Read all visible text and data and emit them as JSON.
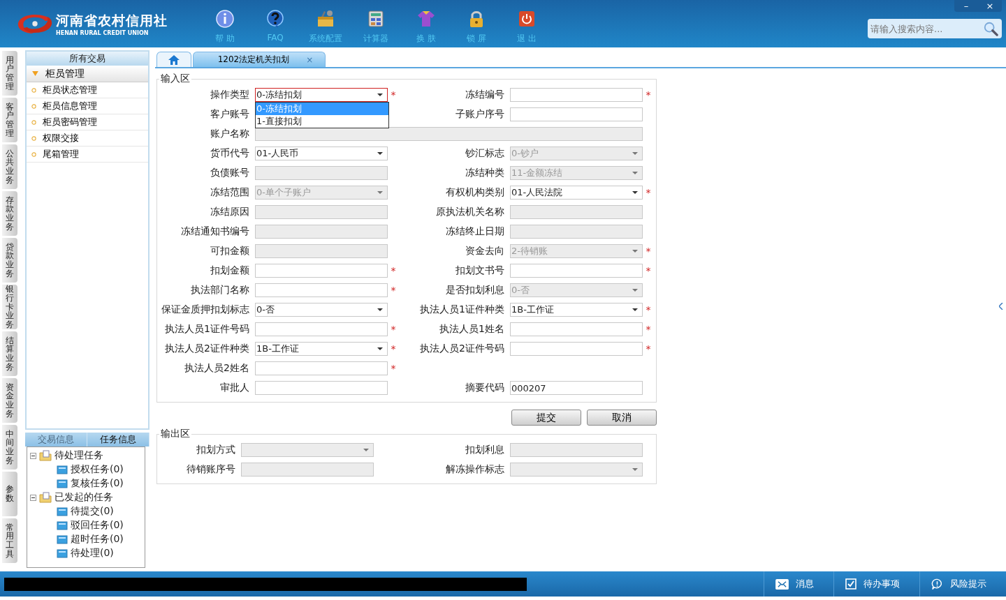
{
  "app": {
    "logo_title": "河南省农村信用社",
    "logo_subtitle": "HENAN RURAL CREDIT UNION"
  },
  "toolbar": [
    {
      "kind": "help",
      "label": "帮 助"
    },
    {
      "kind": "faq",
      "label": "FAQ"
    },
    {
      "kind": "settings",
      "label": "系统配置"
    },
    {
      "kind": "calculator",
      "label": "计算器"
    },
    {
      "kind": "skin",
      "label": "换 肤"
    },
    {
      "kind": "lock",
      "label": "锁 屏"
    },
    {
      "kind": "exit",
      "label": "退 出"
    }
  ],
  "window_controls": [
    "–",
    "×"
  ],
  "search": {
    "placeholder": "请输入搜索内容..."
  },
  "side_tabs": [
    "用户管理",
    "客户管理",
    "公共业务",
    "存款业务",
    "贷款业务",
    "银行卡业务",
    "结算业务",
    "资金业务",
    "中间业务",
    "参数",
    "常用工具"
  ],
  "sidebar": {
    "title": "所有交易",
    "groups": [
      {
        "label": "柜员管理",
        "expanded": true,
        "items": [
          "柜员状态管理",
          "柜员信息管理",
          "柜员密码管理",
          "权限交接",
          "尾箱管理"
        ]
      }
    ]
  },
  "info_tabs": [
    {
      "label": "交易信息",
      "selected": false
    },
    {
      "label": "任务信息",
      "selected": true
    }
  ],
  "task_tree": [
    {
      "label": "待处理任务",
      "expanded": true,
      "children": [
        {
          "label": "授权任务(0)"
        },
        {
          "label": "复核任务(0)"
        }
      ]
    },
    {
      "label": "已发起的任务",
      "expanded": true,
      "children": [
        {
          "label": "待提交(0)"
        },
        {
          "label": "驳回任务(0)"
        },
        {
          "label": "超时任务(0)"
        },
        {
          "label": "待处理(0)"
        }
      ]
    }
  ],
  "tabs": [
    {
      "kind": "home",
      "selected": false
    },
    {
      "kind": "page",
      "label": "1202法定机关扣划",
      "close": "×",
      "selected": true
    }
  ],
  "input_section": {
    "title": "输入区",
    "rows": [
      [
        {
          "label": "操作类型",
          "kind": "select",
          "value": "0-冻结扣划",
          "disabled": false,
          "required": "*",
          "options": [
            {
              "label": "0-冻结扣划",
              "selected": true
            },
            {
              "label": "1-直接扣划",
              "selected": false
            }
          ]
        },
        {
          "label": "冻结编号",
          "kind": "text",
          "disabled": false,
          "required": "*"
        }
      ],
      [
        {
          "label": "客户账号",
          "kind": "text"
        },
        {
          "label": "子账户序号",
          "kind": "text",
          "disabled": false
        }
      ],
      [
        {
          "label": "账户名称",
          "kind": "wide",
          "disabled": true
        }
      ],
      [
        {
          "label": "货币代号",
          "kind": "select",
          "value": "01-人民币",
          "disabled": false
        },
        {
          "label": "钞汇标志",
          "kind": "select",
          "value": "0-钞户",
          "disabled": true
        }
      ],
      [
        {
          "label": "负债账号",
          "kind": "text",
          "disabled": true
        },
        {
          "label": "冻结种类",
          "kind": "select",
          "value": "11-金额冻结",
          "disabled": true
        }
      ],
      [
        {
          "label": "冻结范围",
          "kind": "select",
          "value": "0-单个子账户",
          "disabled": true
        },
        {
          "label": "有权机构类别",
          "kind": "select",
          "value": "01-人民法院",
          "disabled": false,
          "required": "*"
        }
      ],
      [
        {
          "label": "冻结原因",
          "kind": "text",
          "disabled": true
        },
        {
          "label": "原执法机关名称",
          "kind": "text",
          "disabled": true
        }
      ],
      [
        {
          "label": "冻结通知书编号",
          "kind": "text",
          "disabled": true
        },
        {
          "label": "冻结终止日期",
          "kind": "text",
          "disabled": true
        }
      ],
      [
        {
          "label": "可扣金额",
          "kind": "text",
          "disabled": true
        },
        {
          "label": "资金去向",
          "kind": "select",
          "value": "2-待销账",
          "disabled": true,
          "required": "*"
        }
      ],
      [
        {
          "label": "扣划金额",
          "kind": "text",
          "disabled": false,
          "required": "*"
        },
        {
          "label": "扣划文书号",
          "kind": "text",
          "disabled": false,
          "required": "*"
        }
      ],
      [
        {
          "label": "执法部门名称",
          "kind": "text",
          "disabled": false,
          "required": "*"
        },
        {
          "label": "是否扣划利息",
          "kind": "select",
          "value": "0-否",
          "disabled": true
        }
      ],
      [
        {
          "label": "保证金质押扣划标志",
          "kind": "select",
          "value": "0-否",
          "disabled": false
        },
        {
          "label": "执法人员1证件种类",
          "kind": "select",
          "value": "1B-工作证",
          "disabled": false,
          "required": "*"
        }
      ],
      [
        {
          "label": "执法人员1证件号码",
          "kind": "text",
          "disabled": false,
          "required": "*"
        },
        {
          "label": "执法人员1姓名",
          "kind": "text",
          "disabled": false,
          "required": "*"
        }
      ],
      [
        {
          "label": "执法人员2证件种类",
          "kind": "select",
          "value": "1B-工作证",
          "disabled": false,
          "required": "*"
        },
        {
          "label": "执法人员2证件号码",
          "kind": "text",
          "disabled": false,
          "required": "*"
        }
      ],
      [
        {
          "label": "执法人员2姓名",
          "kind": "text",
          "disabled": false,
          "required": "*"
        }
      ],
      [
        {
          "label": "审批人",
          "kind": "text",
          "disabled": false
        },
        {
          "label": "摘要代码",
          "kind": "text",
          "value": "000207",
          "disabled": false
        }
      ]
    ]
  },
  "buttons": [
    "提交",
    "取消"
  ],
  "output_section": {
    "title": "输出区",
    "rows": [
      [
        {
          "label": "扣划方式",
          "kind": "select",
          "disabled": true
        },
        {
          "label": "扣划利息",
          "kind": "text",
          "disabled": true
        }
      ],
      [
        {
          "label": "待销账序号",
          "kind": "text",
          "disabled": true
        },
        {
          "label": "解冻操作标志",
          "kind": "select",
          "disabled": true
        }
      ]
    ]
  },
  "status_items": [
    {
      "kind": "message",
      "label": "消息"
    },
    {
      "kind": "todo",
      "label": "待办事项"
    },
    {
      "kind": "risk",
      "label": "风险提示"
    }
  ]
}
